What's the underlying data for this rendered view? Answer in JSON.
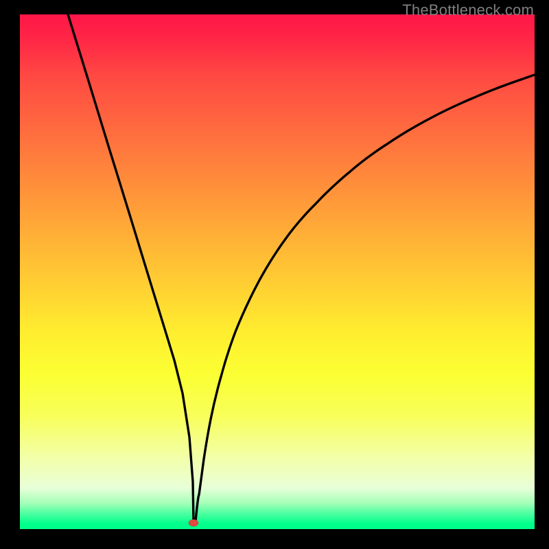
{
  "watermark": "TheBottleneck.com",
  "chart_data": {
    "type": "line",
    "title": "",
    "xlabel": "",
    "ylabel": "",
    "xrange": [
      0,
      750
    ],
    "yrange": [
      0,
      750
    ],
    "series": [
      {
        "name": "bottleneck-curve",
        "note": "V-shaped curve with sharp minimum; x/y in plot-area pixel coords (origin top-left)",
        "x": [
          70,
          100,
          130,
          160,
          190,
          210,
          225,
          237,
          247,
          252,
          253,
          256,
          261,
          268,
          278,
          293,
          315,
          345,
          385,
          430,
          480,
          535,
          595,
          660,
          730,
          750
        ],
        "y": [
          0,
          97,
          195,
          292,
          390,
          455,
          504,
          552,
          616,
          681,
          738,
          738,
          700,
          648,
          590,
          528,
          460,
          395,
          330,
          277,
          230,
          189,
          153,
          122,
          95,
          88
        ]
      }
    ],
    "marker": {
      "x": 253,
      "y": 741,
      "color": "#e04a3f",
      "rx": 7,
      "ry": 5
    },
    "background_gradient": {
      "orientation": "vertical",
      "stops": [
        {
          "pos": 0.0,
          "color": "#ff1648"
        },
        {
          "pos": 0.5,
          "color": "#ffcc33"
        },
        {
          "pos": 0.8,
          "color": "#f8ff5a"
        },
        {
          "pos": 1.0,
          "color": "#00ff89"
        }
      ]
    }
  }
}
